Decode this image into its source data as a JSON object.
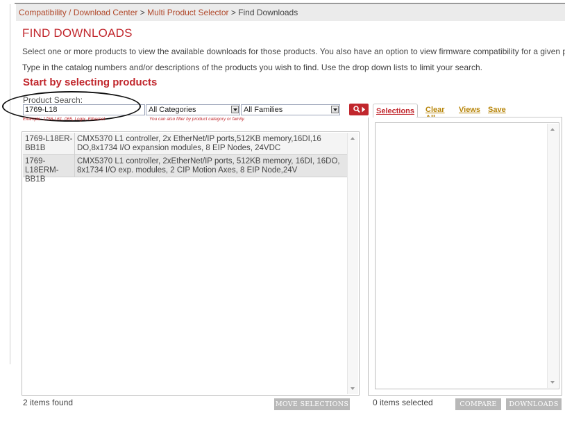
{
  "breadcrumb": {
    "item1": "Compatibility / Download Center",
    "sep1": " > ",
    "item2": "Multi Product Selector",
    "sep2": " > ",
    "current": "Find Downloads"
  },
  "page_title": "FIND DOWNLOADS",
  "intro_line1": "Select one or more products to view the available downloads for those products. You also have an option to view firmware compatibility for a given product.",
  "intro_line2": "Type in the catalog numbers and/or descriptions of the products you wish to find. Use the drop down lists to limit your search.",
  "subtitle": "Start by selecting products",
  "search": {
    "label": "Product Search:",
    "value": "1769-L18",
    "hint": "Example: 1756-L61, 065, Logix, Ethernet",
    "category_selected": "All Categories",
    "family_selected": "All Families",
    "filter_hint": "You can also filter by product category or family."
  },
  "results": [
    {
      "catalog": "1769-L18ER-BB1B",
      "description": "CMX5370 L1 controller, 2x EtherNet/IP ports,512KB memory,16DI,16 DO,8x1734 I/O expansion modules, 8 EIP Nodes, 24VDC"
    },
    {
      "catalog": "1769-L18ERM-BB1B",
      "description": "CMX5370 L1 controller, 2xEtherNet/IP ports, 512KB memory, 16DI, 16DO, 8x1734 I/O exp. modules, 2 CIP Motion Axes, 8 EIP Node,24V"
    }
  ],
  "tabs": {
    "selections": "Selections",
    "clear_all": "Clear All",
    "views": "Views",
    "save": "Save"
  },
  "footer": {
    "items_found": "2 items found",
    "move_selections": "MOVE SELECTIONS ►",
    "items_selected": "0 items selected",
    "compare": "COMPARE",
    "downloads": "DOWNLOADS"
  },
  "colors": {
    "accent": "#c1272d",
    "link": "#b8860b"
  }
}
